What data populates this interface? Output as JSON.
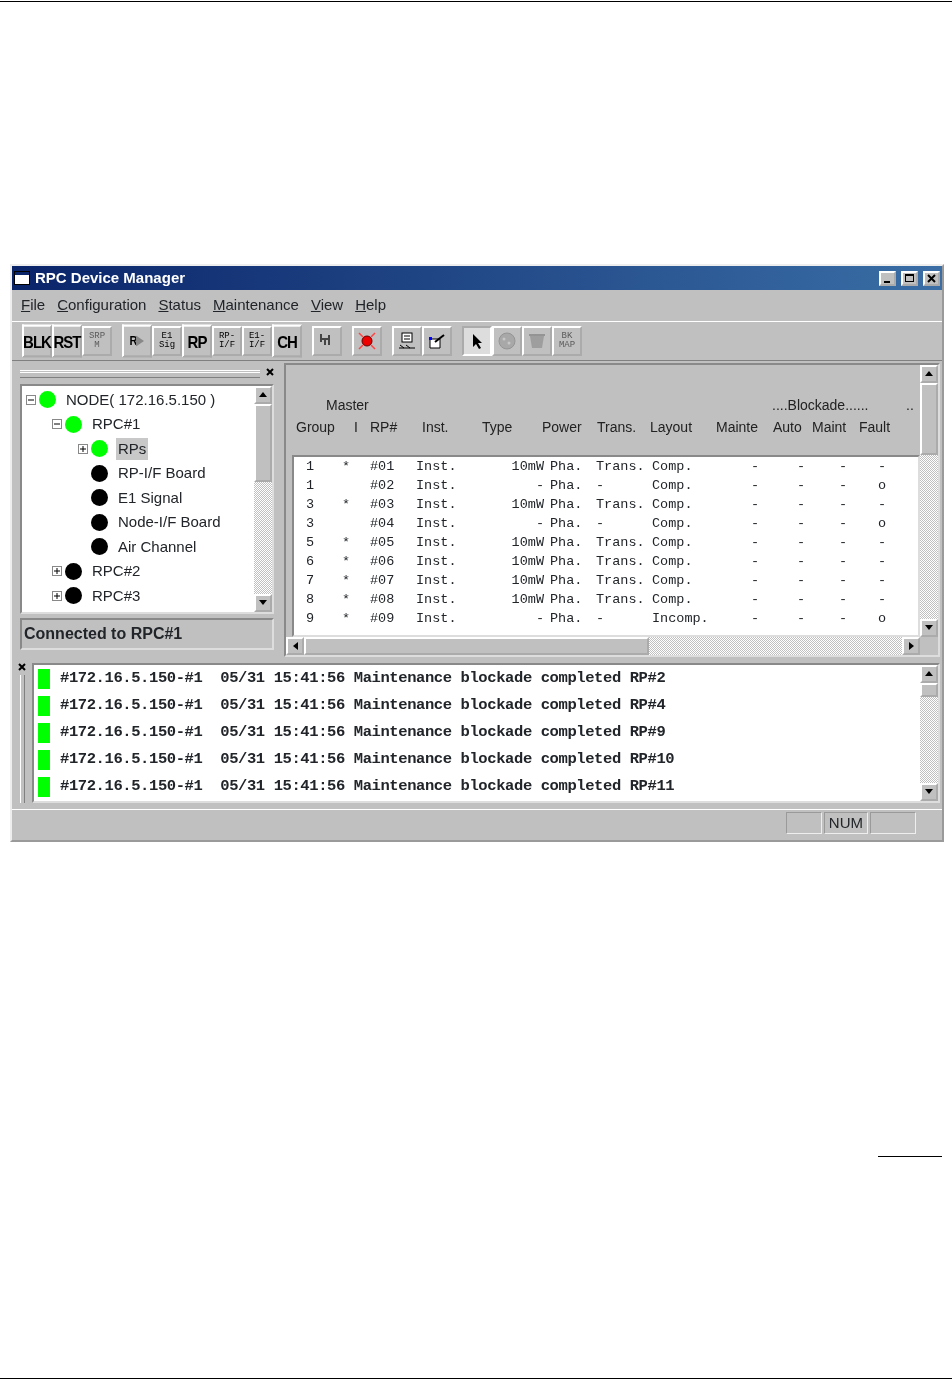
{
  "window": {
    "title": "RPC Device Manager"
  },
  "menu": [
    "File",
    "Configuration",
    "Status",
    "Maintenance",
    "View",
    "Help"
  ],
  "toolbar": [
    [
      {
        "kind": "text",
        "label": "BLK",
        "disabled": false
      },
      {
        "kind": "text",
        "label": "RST",
        "disabled": false
      },
      {
        "kind": "text-small",
        "label": "SRP M",
        "disabled": true
      }
    ],
    [
      {
        "kind": "text-arrow",
        "label": "R",
        "disabled": false
      },
      {
        "kind": "text-small",
        "label": "E1 Sig",
        "disabled": false
      },
      {
        "kind": "text",
        "label": "RP",
        "disabled": false
      },
      {
        "kind": "text-small",
        "label": "RP- I/F",
        "disabled": false
      },
      {
        "kind": "text-small",
        "label": "E1- I/F",
        "disabled": false
      },
      {
        "kind": "text",
        "label": "CH",
        "disabled": false
      }
    ],
    [
      {
        "kind": "fork",
        "disabled": false
      }
    ],
    [
      {
        "kind": "alarm",
        "disabled": false
      }
    ],
    [
      {
        "kind": "monitor",
        "disabled": false
      },
      {
        "kind": "export",
        "disabled": false
      }
    ],
    [
      {
        "kind": "pointer",
        "disabled": false,
        "pressed": true
      },
      {
        "kind": "globe",
        "disabled": true
      },
      {
        "kind": "bin",
        "disabled": true
      },
      {
        "kind": "text-small",
        "label": "BK MAP",
        "disabled": true
      }
    ]
  ],
  "tree": [
    {
      "label": "NODE( 172.16.5.150 )",
      "color": "#00ff00",
      "expanded": true,
      "selected": false,
      "children": [
        {
          "label": "RPC#1",
          "color": "#00ff00",
          "expanded": true,
          "selected": false,
          "children": [
            {
              "label": "RPs",
              "color": "#00ff00",
              "expanded": false,
              "selected": true
            },
            {
              "label": "RP-I/F Board",
              "color": "#000000",
              "selected": false
            },
            {
              "label": "E1 Signal",
              "color": "#000000",
              "selected": false
            },
            {
              "label": "Node-I/F Board",
              "color": "#000000",
              "selected": false
            },
            {
              "label": "Air Channel",
              "color": "#000000",
              "selected": false
            }
          ]
        },
        {
          "label": "RPC#2",
          "color": "#000000",
          "expanded": false,
          "selected": false
        },
        {
          "label": "RPC#3",
          "color": "#000000",
          "expanded": false,
          "selected": false
        }
      ]
    }
  ],
  "connection_status": "Connected to RPC#1",
  "table": {
    "group_headers": [
      "Master",
      "....Blockade......",
      ".."
    ],
    "columns": [
      "Group",
      "I",
      "RP#",
      "Inst.",
      "Type",
      "Power",
      "Trans.",
      "Layout",
      "Mainte",
      "Auto",
      "Maint",
      "Fault"
    ],
    "rows": [
      [
        "1",
        "*",
        "#01",
        "Inst.",
        "10mW",
        "Pha.",
        "Trans.",
        "Comp.",
        "-",
        "-",
        "-",
        "-"
      ],
      [
        "1",
        null,
        "#02",
        "Inst.",
        "-",
        "Pha.",
        "-",
        "Comp.",
        "-",
        "-",
        "-",
        "o"
      ],
      [
        "3",
        "*",
        "#03",
        "Inst.",
        "10mW",
        "Pha.",
        "Trans.",
        "Comp.",
        "-",
        "-",
        "-",
        "-"
      ],
      [
        "3",
        null,
        "#04",
        "Inst.",
        "-",
        "Pha.",
        "-",
        "Comp.",
        "-",
        "-",
        "-",
        "o"
      ],
      [
        "5",
        "*",
        "#05",
        "Inst.",
        "10mW",
        "Pha.",
        "Trans.",
        "Comp.",
        "-",
        "-",
        "-",
        "-"
      ],
      [
        "6",
        "*",
        "#06",
        "Inst.",
        "10mW",
        "Pha.",
        "Trans.",
        "Comp.",
        "-",
        "-",
        "-",
        "-"
      ],
      [
        "7",
        "*",
        "#07",
        "Inst.",
        "10mW",
        "Pha.",
        "Trans.",
        "Comp.",
        "-",
        "-",
        "-",
        "-"
      ],
      [
        "8",
        "*",
        "#08",
        "Inst.",
        "10mW",
        "Pha.",
        "Trans.",
        "Comp.",
        "-",
        "-",
        "-",
        "-"
      ],
      [
        "9",
        "*",
        "#09",
        "Inst.",
        "-",
        "Pha.",
        "-",
        "Incomp.",
        "-",
        "-",
        "-",
        "o"
      ]
    ]
  },
  "log": [
    {
      "color": "#00ff00",
      "text": "#172.16.5.150-#1  05/31 15:41:56 Maintenance blockade completed RP#2"
    },
    {
      "color": "#00ff00",
      "text": "#172.16.5.150-#1  05/31 15:41:56 Maintenance blockade completed RP#4"
    },
    {
      "color": "#00ff00",
      "text": "#172.16.5.150-#1  05/31 15:41:56 Maintenance blockade completed RP#9"
    },
    {
      "color": "#00ff00",
      "text": "#172.16.5.150-#1  05/31 15:41:56 Maintenance blockade completed RP#10"
    },
    {
      "color": "#00ff00",
      "text": "#172.16.5.150-#1  05/31 15:41:56 Maintenance blockade completed RP#11"
    }
  ],
  "status_bar": {
    "indicator": "NUM"
  }
}
